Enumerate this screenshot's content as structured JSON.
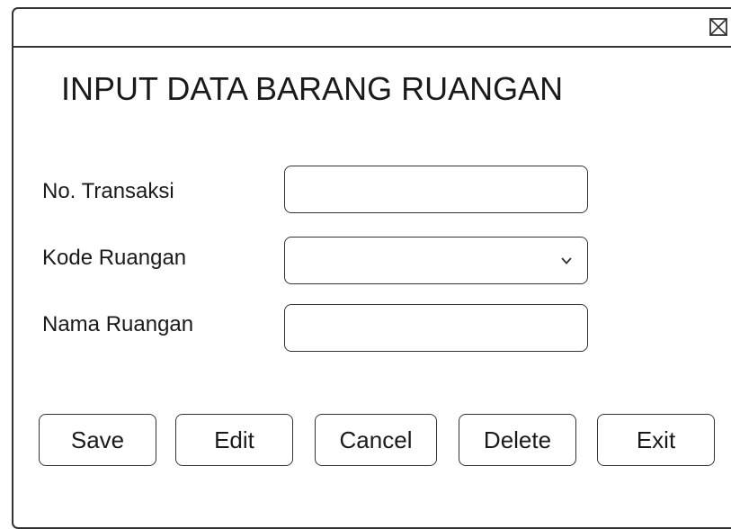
{
  "window": {
    "close_icon": "close-x-box-icon"
  },
  "form": {
    "title": "INPUT DATA BARANG RUANGAN",
    "fields": [
      {
        "label": "No. Transaksi",
        "type": "text",
        "value": ""
      },
      {
        "label": "Kode Ruangan",
        "type": "dropdown",
        "value": "",
        "icon": "chevron-down-icon"
      },
      {
        "label": "Nama Ruangan",
        "type": "text",
        "value": ""
      }
    ]
  },
  "buttons": {
    "save": "Save",
    "edit": "Edit",
    "cancel": "Cancel",
    "delete": "Delete",
    "exit": "Exit"
  },
  "colors": {
    "border": "#333333",
    "text": "#1a1a1a",
    "background": "#ffffff"
  }
}
